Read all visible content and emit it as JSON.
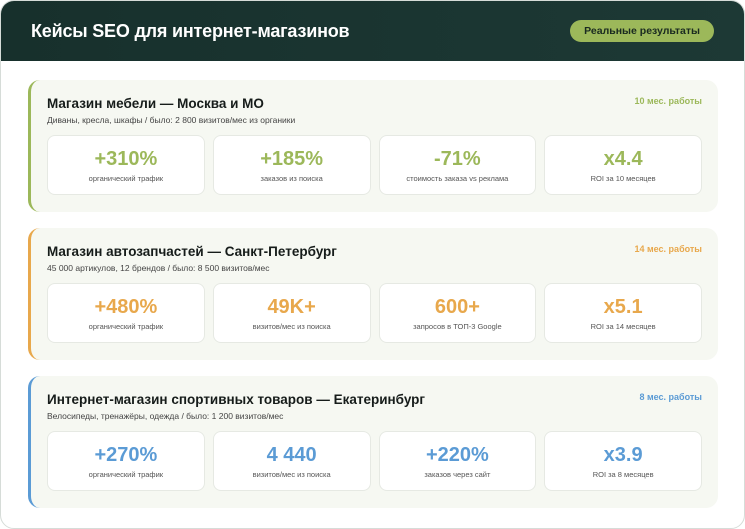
{
  "header": {
    "title": "Кейсы SEO для интернет-магазинов",
    "badge": "Реальные результаты"
  },
  "colors": {
    "green": "#9cb85a",
    "orange": "#e8a84c",
    "blue": "#5b9bd5"
  },
  "cases": [
    {
      "title": "Магазин мебели — Москва и МО",
      "duration": "10 мес. работы",
      "subtitle": "Диваны, кресла, шкафы / было: 2 800 визитов/мес из органики",
      "stats": [
        {
          "value": "+310%",
          "label": "органический трафик"
        },
        {
          "value": "+185%",
          "label": "заказов из поиска"
        },
        {
          "value": "-71%",
          "label": "стоимость заказа vs реклама"
        },
        {
          "value": "x4.4",
          "label": "ROI за 10 месяцев"
        }
      ]
    },
    {
      "title": "Магазин автозапчастей — Санкт-Петербург",
      "duration": "14 мес. работы",
      "subtitle": "45 000 артикулов, 12 брендов / было: 8 500 визитов/мес",
      "stats": [
        {
          "value": "+480%",
          "label": "органический трафик"
        },
        {
          "value": "49K+",
          "label": "визитов/мес из поиска"
        },
        {
          "value": "600+",
          "label": "запросов в ТОП-3 Google"
        },
        {
          "value": "x5.1",
          "label": "ROI за 14 месяцев"
        }
      ]
    },
    {
      "title": "Интернет-магазин спортивных товаров — Екатеринбург",
      "duration": "8 мес. работы",
      "subtitle": "Велосипеды, тренажёры, одежда / было: 1 200 визитов/мес",
      "stats": [
        {
          "value": "+270%",
          "label": "органический трафик"
        },
        {
          "value": "4 440",
          "label": "визитов/мес из поиска"
        },
        {
          "value": "+220%",
          "label": "заказов через сайт"
        },
        {
          "value": "x3.9",
          "label": "ROI за 8 месяцев"
        }
      ]
    }
  ]
}
